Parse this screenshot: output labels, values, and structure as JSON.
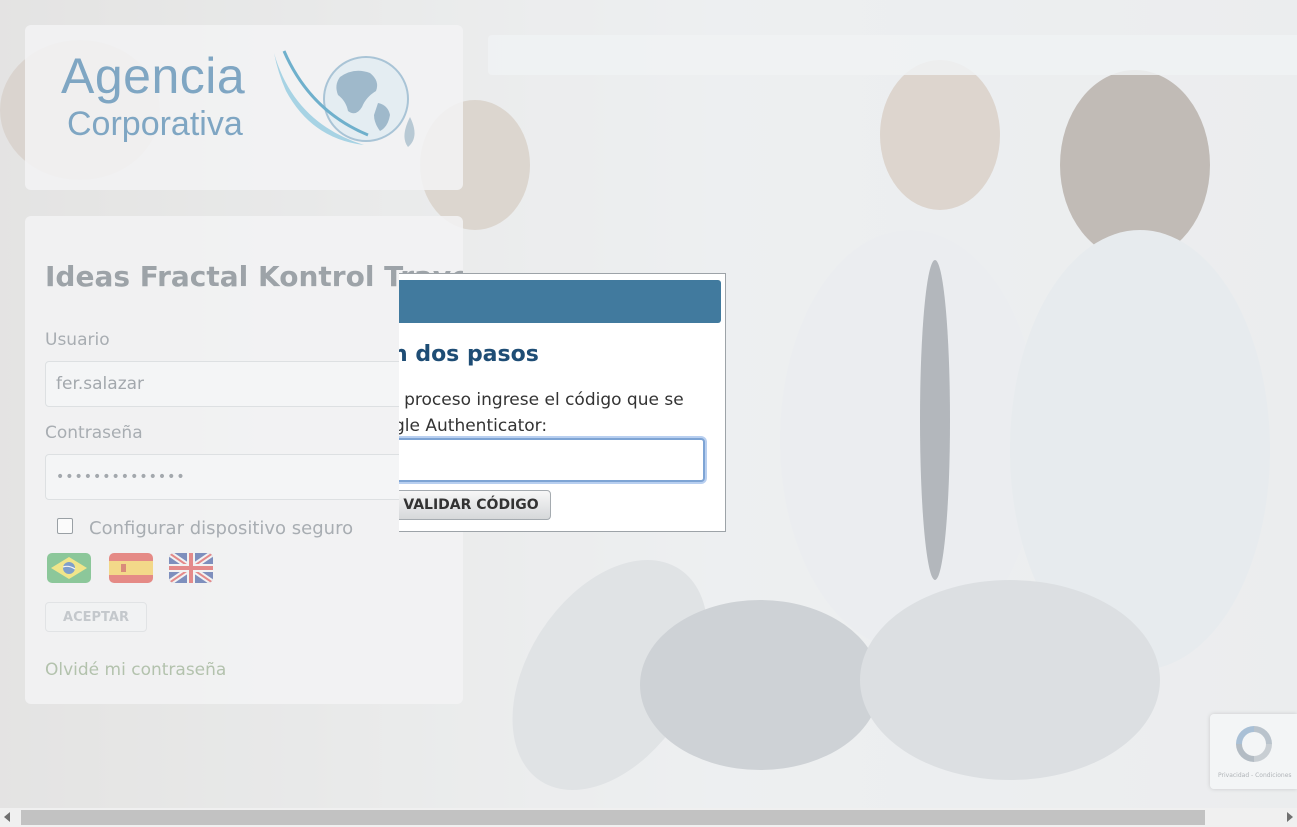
{
  "logo": {
    "line1": "Agencia",
    "line2": "Corporativa",
    "globe_icon": "globe-swoosh-icon"
  },
  "login": {
    "title": "Ideas Fractal Kontrol Travel",
    "user_label": "Usuario",
    "user_value": "fer.salazar",
    "password_label": "Contraseña",
    "password_value": "••••••••••••••",
    "secure_device_label": "Configurar dispositivo seguro",
    "languages": [
      "pt-BR",
      "es",
      "en"
    ],
    "accept_label": "ACEPTAR",
    "forgot_label": "Olvidé mi contraseña"
  },
  "modal": {
    "title_visible": "n dos pasos",
    "instruction_line1": "l proceso ingrese el código que se",
    "instruction_line2": "gle Authenticator:",
    "code_value": "",
    "validate_label": "VALIDAR CÓDIGO",
    "header_color": "#417a9e"
  },
  "recaptcha": {
    "icon": "recaptcha-icon",
    "footer": "Privacidad - Condiciones"
  }
}
